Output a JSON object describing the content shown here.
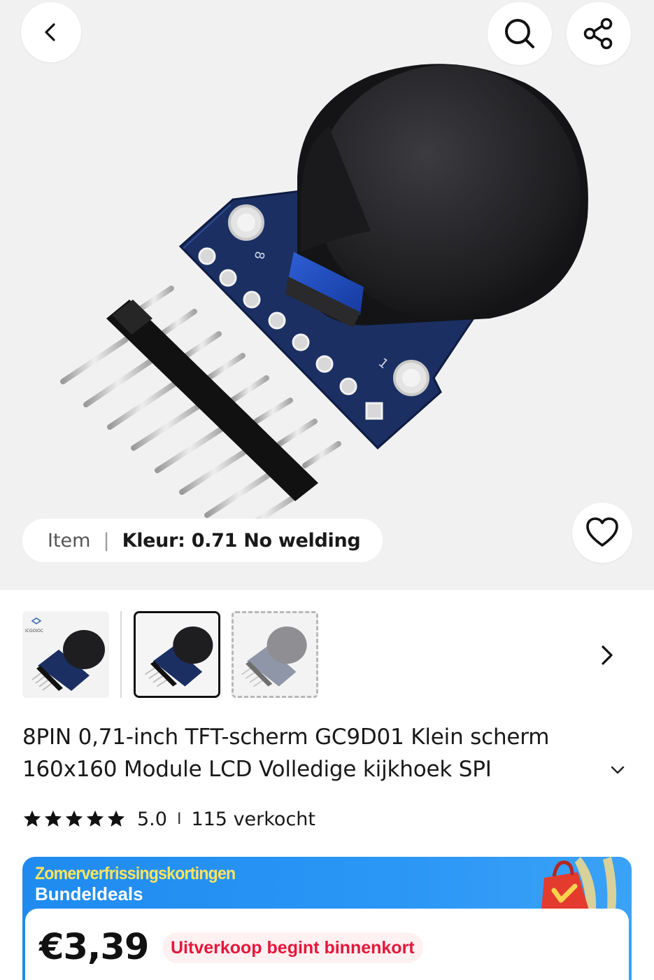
{
  "hero": {
    "variant_pill": {
      "label": "Item",
      "separator": "|",
      "value": "Kleur: 0.71 No welding"
    },
    "icons": {
      "back": "chevron-left-icon",
      "search": "search-icon",
      "share": "share-icon",
      "wishlist": "heart-icon"
    }
  },
  "thumbnails": {
    "items": [
      {
        "name": "thumb-with-logo",
        "logo_text": "ICGOIOC",
        "selected": false
      },
      {
        "name": "thumb-selected",
        "selected": true
      },
      {
        "name": "thumb-faded",
        "selected": false
      }
    ],
    "next_icon": "chevron-right-icon"
  },
  "product": {
    "title": "8PIN 0,71-inch TFT-scherm GC9D01 Klein scherm 160x160 Module LCD Volledige kijkhoek SPI",
    "rating": "5.0",
    "rating_separator": "I",
    "sold": "115 verkocht",
    "stars": 5
  },
  "promo": {
    "title": "Zomerverfrissingskortingen",
    "subtitle": "Bundeldeals",
    "price": "€3,39",
    "badge": "Uitverkoop begint binnenkort"
  },
  "colors": {
    "promo_blue": "#2a96f5",
    "promo_yellow": "#ffe45c",
    "badge_red": "#e5173b",
    "pcb_blue": "#1b2f63"
  }
}
